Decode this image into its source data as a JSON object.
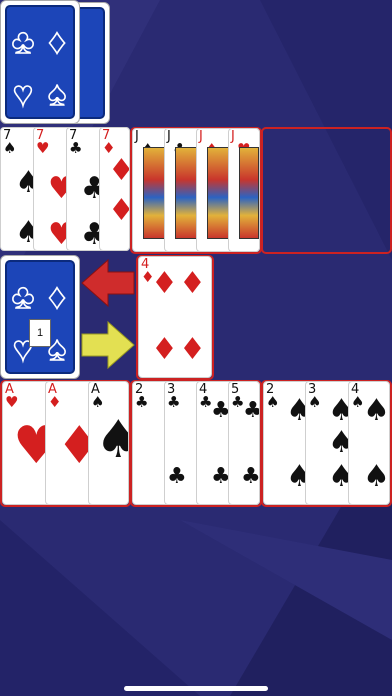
{
  "stock": {
    "count_label": "1"
  },
  "colors": {
    "background": "#2a2a72",
    "card_red": "#d41f1f",
    "card_back": "#1c45b8",
    "frame_red": "#cc2222",
    "arrow_red": "#cf2c2c",
    "arrow_yellow": "#e3e052"
  },
  "top_deck": {
    "icon": "card-back-pair"
  },
  "row1_group1": [
    {
      "rank": "7",
      "suit": "♠",
      "color": "black"
    },
    {
      "rank": "7",
      "suit": "♥",
      "color": "red"
    },
    {
      "rank": "7",
      "suit": "♣",
      "color": "black"
    },
    {
      "rank": "7",
      "suit": "♦",
      "color": "red"
    }
  ],
  "row1_group2": [
    {
      "rank": "J",
      "suit": "♠",
      "color": "black"
    },
    {
      "rank": "J",
      "suit": "♣",
      "color": "black"
    },
    {
      "rank": "J",
      "suit": "♦",
      "color": "red"
    },
    {
      "rank": "J",
      "suit": "♥",
      "color": "red"
    }
  ],
  "discard": {
    "rank": "4",
    "suit": "♦",
    "color": "red"
  },
  "row3_group1": [
    {
      "rank": "A",
      "suit": "♥",
      "color": "red"
    },
    {
      "rank": "A",
      "suit": "♦",
      "color": "red"
    },
    {
      "rank": "A",
      "suit": "♠",
      "color": "black"
    }
  ],
  "row3_group2": [
    {
      "rank": "2",
      "suit": "♣",
      "color": "black"
    },
    {
      "rank": "3",
      "suit": "♣",
      "color": "black"
    },
    {
      "rank": "4",
      "suit": "♣",
      "color": "black"
    },
    {
      "rank": "5",
      "suit": "♣",
      "color": "black"
    }
  ],
  "row3_group3": [
    {
      "rank": "2",
      "suit": "♠",
      "color": "black"
    },
    {
      "rank": "3",
      "suit": "♠",
      "color": "black"
    },
    {
      "rank": "4",
      "suit": "♠",
      "color": "black"
    }
  ]
}
